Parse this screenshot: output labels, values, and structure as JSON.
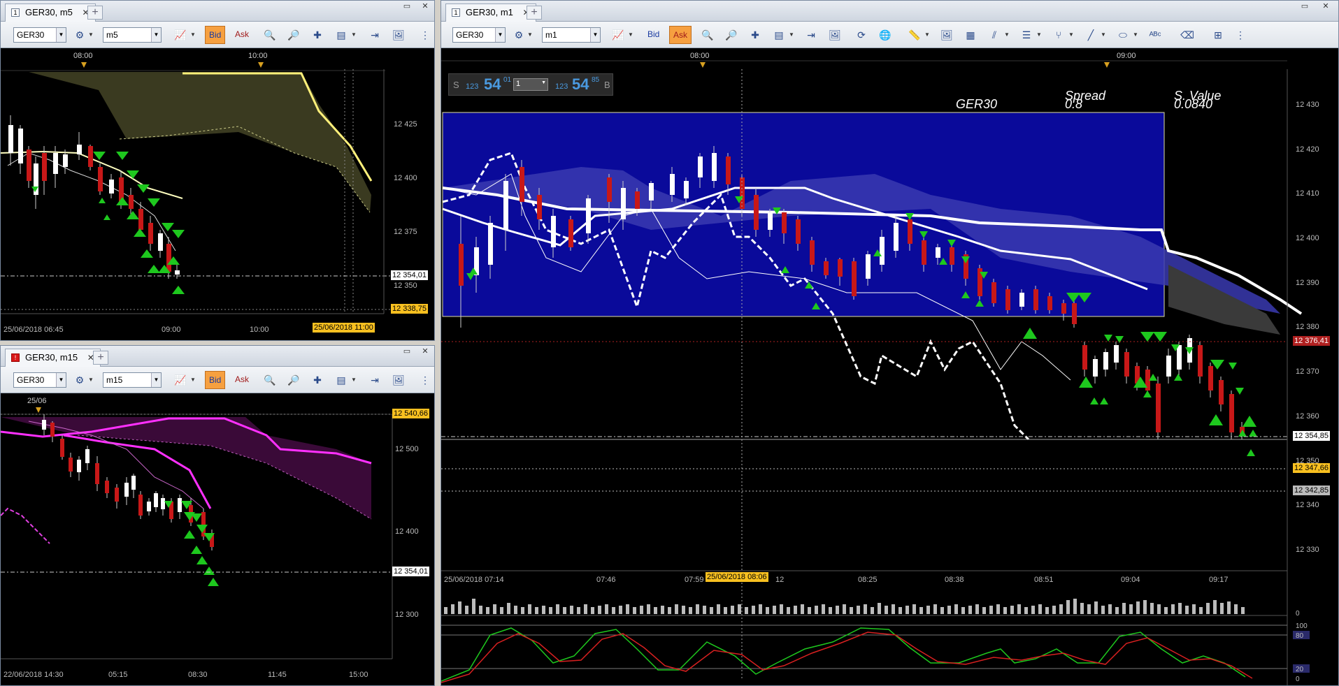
{
  "windows": {
    "m5": {
      "tab_title": "GER30, m5",
      "tab_icon": "chart-window-icon",
      "symbol": "GER30",
      "timeframe": "m5",
      "bid_label": "Bid",
      "ask_label": "Ask",
      "active_price": "Bid",
      "top_times": [
        "08:00",
        "10:00"
      ],
      "price_ticks": [
        "12 425",
        "12 400",
        "12 375",
        "12 350"
      ],
      "price_current": "12 354,01",
      "price_marker": "12 338,75",
      "time_labels": [
        "25/06/2018 06:45",
        "09:00",
        "10:00"
      ],
      "time_cursor": "25/06/2018 11:00"
    },
    "m15": {
      "tab_title": "GER30, m15",
      "tab_icon": "chart-window-alert-icon",
      "symbol": "GER30",
      "timeframe": "m15",
      "bid_label": "Bid",
      "ask_label": "Ask",
      "active_price": "Bid",
      "top_times": [
        "25/06"
      ],
      "price_ticks": [
        "12 500",
        "12 400",
        "12 300"
      ],
      "price_marker": "12 540,66",
      "price_current": "12 354,01",
      "time_labels": [
        "22/06/2018 14:30",
        "05:15",
        "08:30",
        "11:45",
        "15:00"
      ]
    },
    "m1": {
      "tab_title": "GER30, m1",
      "tab_icon": "chart-window-icon",
      "symbol": "GER30",
      "timeframe": "m1",
      "bid_label": "Bid",
      "ask_label": "Ask",
      "active_price": "Ask",
      "top_times": [
        "08:00",
        "09:00"
      ],
      "trade_panel": {
        "sell_label": "S",
        "sell_small": "123",
        "sell_big": "54",
        "sell_sup": "01",
        "qty": "1",
        "buy_small": "123",
        "buy_big": "54",
        "buy_sup": "85",
        "buy_label": "B"
      },
      "info": {
        "symbol": "GER30",
        "spread_label": "Spread",
        "spread_value": "0.8",
        "svalue_label": "S. Value",
        "svalue_value": "0.0840"
      },
      "price_ticks": [
        "12 430",
        "12 420",
        "12 410",
        "12 400",
        "12 390",
        "12 380",
        "12 370",
        "12 360",
        "12 350",
        "12 340",
        "12 330"
      ],
      "price_red": "12 376,41",
      "price_current": "12 354,85",
      "price_marker_orange": "12 347,66",
      "price_marker_grey": "12 342,85",
      "time_labels": [
        "25/06/2018 07:14",
        "07:46",
        "07:59",
        "12",
        "08:25",
        "08:38",
        "08:51",
        "09:04",
        "09:17"
      ],
      "time_cursor": "25/06/2018 08:06",
      "volume_zero": "0",
      "osc_ticks": [
        "100",
        "80",
        "20",
        "0"
      ]
    }
  },
  "colors": {
    "active_button": "#f6a040",
    "ichimoku_m5": "#3a3a20",
    "ichimoku_m15": "#3a0a38",
    "highlight_box": "#0a0a9a",
    "up_candle": "#ffffff",
    "down_candle": "#c81818",
    "arrow": "#1ec81e"
  }
}
